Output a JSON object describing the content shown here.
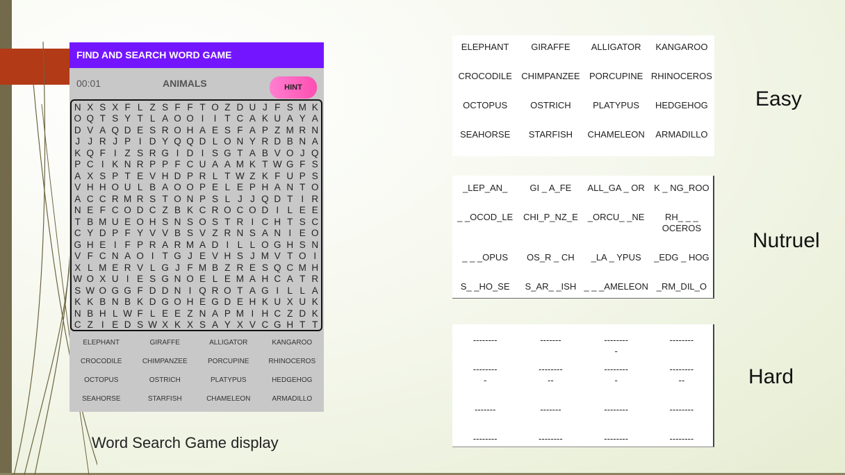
{
  "game": {
    "title": "FIND AND SEARCH WORD GAME",
    "timer": "00:01",
    "category": "ANIMALS",
    "hint_label": "HINT",
    "grid": [
      "NXSXFLZSFFTOZDUJFSMK",
      "OQTSYTLAOOIITCAKUAYA",
      "DVAQDESROHAESFAPZMRN",
      "JJRJPIDYQQDLONYRDBNA",
      "KQFIZSRGIDISGTABVOJQ",
      "PCIKNRPPFCUAAMKTWGFS",
      "AXSPTEVHDPRLTWZKFUPS",
      "VHHOULBAOOPELEPHANTO",
      "ACCRMRSTONPSLJJQDTIR",
      "NEFCODCZBKCROCODILEE",
      "TBMUEOHSNSOSTRICHTSC",
      "CYDPFYVVBSVZRNSANIEO",
      "GHEIFPRARMADILLOGHSN",
      "VFCNAOITGJEVHSJMVTOI",
      "XLMERVLGJFMBZRESQCMH",
      "WOXUIESGNOELEMAHCATR",
      "SWOGGFDDNIQROTAGILLA",
      "KKBNBKDGOHEGDEHKUXUK",
      "NBHLWFLEEZNAPMIHCZDK",
      "CZIEDSWXKXSAYXVCGHTT"
    ],
    "words": [
      [
        "ELEPHANT",
        "GIRAFFE",
        "ALLIGATOR",
        "KANGAROO"
      ],
      [
        "CROCODILE",
        "CHIMPANZEE",
        "PORCUPINE",
        "RHINOCEROS"
      ],
      [
        "OCTOPUS",
        "OSTRICH",
        "PLATYPUS",
        "HEDGEHOG"
      ],
      [
        "SEAHORSE",
        "STARFISH",
        "CHAMELEON",
        "ARMADILLO"
      ]
    ]
  },
  "caption": "Word Search Game display",
  "levels": {
    "easy": {
      "label": "Easy",
      "rows": [
        [
          "ELEPHANT",
          "GIRAFFE",
          "ALLIGATOR",
          "KANGAROO"
        ],
        [
          "CROCODILE",
          "CHIMPANZEE",
          "PORCUPINE",
          "RHINOCEROS"
        ],
        [
          "OCTOPUS",
          "OSTRICH",
          "PLATYPUS",
          "HEDGEHOG"
        ],
        [
          "SEAHORSE",
          "STARFISH",
          "CHAMELEON",
          "ARMADILLO"
        ]
      ]
    },
    "neutral": {
      "label": "Nutruel",
      "rows": [
        [
          "_LEP_AN_",
          "GI _ A_FE",
          "ALL_GA _ OR",
          "K _ NG_ROO"
        ],
        [
          "_ _OCOD_LE",
          "CHI_P_NZ_E",
          "_ORCU_ _NE",
          "RH_ _ _\nOCEROS"
        ],
        [
          "_ _ _OPUS",
          "OS_R _ CH",
          "_LA _ YPUS",
          "_EDG _ HOG"
        ],
        [
          "S_ _HO_SE",
          "S_AR_ _ISH",
          "_ _ _AMELEON",
          "_RM_DIL_O"
        ]
      ]
    },
    "hard": {
      "label": "Hard",
      "rows": [
        [
          "--------",
          "-------",
          "--------\n-",
          "--------"
        ],
        [
          "--------\n-",
          "--------\n--",
          "--------\n-",
          "--------\n--"
        ],
        [
          "-------",
          "-------",
          "--------",
          "--------"
        ],
        [
          "--------",
          "--------",
          "--------",
          "--------"
        ]
      ]
    }
  },
  "colors": {
    "header": "#7316ff",
    "hint": "#ff5fb9",
    "accent_red": "#b23a17",
    "side_bar": "#736a4c"
  }
}
